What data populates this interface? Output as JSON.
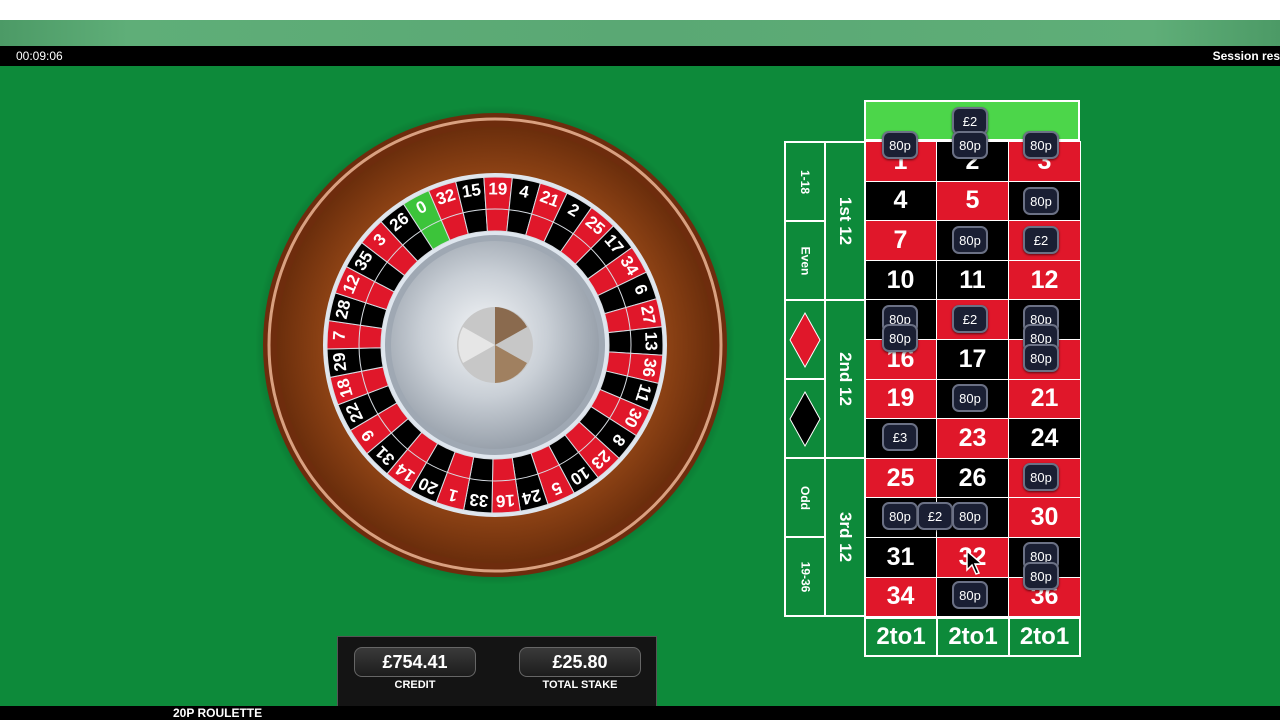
{
  "header": {
    "timer": "00:09:06",
    "session_text": "Session res"
  },
  "footer": {
    "game_name": "20P ROULETTE"
  },
  "wheel": {
    "sequence": [
      "0",
      "32",
      "15",
      "19",
      "4",
      "21",
      "2",
      "25",
      "17",
      "34",
      "6",
      "27",
      "13",
      "36",
      "11",
      "30",
      "8",
      "23",
      "10",
      "5",
      "24",
      "16",
      "33",
      "1",
      "20",
      "14",
      "31",
      "9",
      "22",
      "18",
      "29",
      "7",
      "28",
      "12",
      "35",
      "3",
      "26"
    ],
    "reds": [
      "32",
      "19",
      "21",
      "25",
      "34",
      "27",
      "36",
      "30",
      "23",
      "5",
      "16",
      "1",
      "14",
      "9",
      "18",
      "7",
      "12",
      "3"
    ],
    "colors": {
      "red": "#e0172a",
      "black": "#000000",
      "green": "#3cc43a",
      "wood": "#8a3f12",
      "rim": "#6b2a0c"
    }
  },
  "table": {
    "numbers": [
      [
        "1",
        "2",
        "3"
      ],
      [
        "4",
        "5",
        "6"
      ],
      [
        "7",
        "8",
        "9"
      ],
      [
        "10",
        "11",
        "12"
      ],
      [
        "13",
        "14",
        "15"
      ],
      [
        "16",
        "17",
        "18"
      ],
      [
        "19",
        "20",
        "21"
      ],
      [
        "22",
        "23",
        "24"
      ],
      [
        "25",
        "26",
        "27"
      ],
      [
        "28",
        "29",
        "30"
      ],
      [
        "31",
        "32",
        "33"
      ],
      [
        "34",
        "35",
        "36"
      ]
    ],
    "dozens": [
      "1st 12",
      "2nd 12",
      "3rd 12"
    ],
    "outside": [
      "1-18",
      "Even",
      "Odd",
      "19-36"
    ],
    "column_bets": [
      "2to1",
      "2to1",
      "2to1"
    ],
    "chips": [
      "£2",
      "80p",
      "80p",
      "80p",
      "80p",
      "80p",
      "£2",
      "80p",
      "80p",
      "£2",
      "80p",
      "80p",
      "80p",
      "80p",
      "80p",
      "£3",
      "80p",
      "£2",
      "80p",
      "80p",
      "80p",
      "80p"
    ]
  },
  "panel": {
    "credit_value": "£754.41",
    "credit_label": "CREDIT",
    "stake_value": "£25.80",
    "stake_label": "TOTAL STAKE"
  }
}
